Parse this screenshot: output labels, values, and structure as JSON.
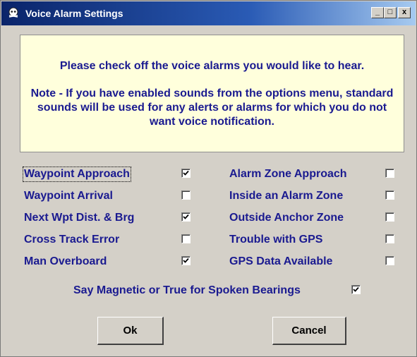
{
  "window": {
    "title": "Voice Alarm Settings",
    "controls": {
      "minimize": "_",
      "maximize": "□",
      "close": "x"
    }
  },
  "panel": {
    "line1": "Please check off the voice alarms you would like to hear.",
    "note": "Note - If you have enabled sounds from the options menu, standard sounds will be used for any alerts or alarms for which you do not want voice notification."
  },
  "left_options": [
    {
      "label": "Waypoint Approach",
      "checked": true
    },
    {
      "label": "Waypoint Arrival",
      "checked": false
    },
    {
      "label": "Next Wpt Dist. & Brg",
      "checked": true
    },
    {
      "label": "Cross Track Error",
      "checked": false
    },
    {
      "label": "Man Overboard",
      "checked": true
    }
  ],
  "right_options": [
    {
      "label": "Alarm Zone Approach",
      "checked": false
    },
    {
      "label": "Inside an Alarm Zone",
      "checked": false
    },
    {
      "label": "Outside Anchor Zone",
      "checked": false
    },
    {
      "label": "Trouble with GPS",
      "checked": false
    },
    {
      "label": "GPS Data Available",
      "checked": false
    }
  ],
  "bearing_option": {
    "label": "Say Magnetic or True for Spoken Bearings",
    "checked": true
  },
  "buttons": {
    "ok": "Ok",
    "cancel": "Cancel"
  },
  "colors": {
    "title_bar": "#0a246a",
    "dialog_bg": "#d4d0c8",
    "panel_bg": "#ffffdc",
    "text": "#1a1a90"
  }
}
